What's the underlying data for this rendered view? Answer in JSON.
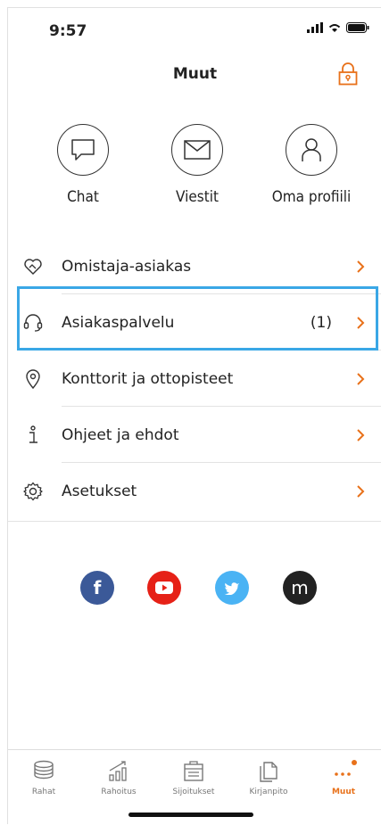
{
  "status": {
    "time": "9:57"
  },
  "header": {
    "title": "Muut"
  },
  "quick_actions": [
    {
      "label": "Chat"
    },
    {
      "label": "Viestit"
    },
    {
      "label": "Oma profiili"
    }
  ],
  "menu": {
    "items": [
      {
        "label": "Omistaja-asiakas",
        "count": ""
      },
      {
        "label": "Asiakaspalvelu",
        "count": "(1)"
      },
      {
        "label": "Konttorit ja ottopisteet",
        "count": ""
      },
      {
        "label": "Ohjeet ja ehdot",
        "count": ""
      },
      {
        "label": "Asetukset",
        "count": ""
      }
    ]
  },
  "social": [
    {
      "name": "facebook-icon",
      "glyph": "f",
      "color": "#3b5998"
    },
    {
      "name": "youtube-icon",
      "glyph": "",
      "color": "#e62117"
    },
    {
      "name": "twitter-icon",
      "glyph": "",
      "color": "#4ab3f4"
    },
    {
      "name": "medium-icon",
      "glyph": "m",
      "color": "#222222"
    }
  ],
  "tabs": [
    {
      "label": "Rahat"
    },
    {
      "label": "Rahoitus"
    },
    {
      "label": "Sijoitukset"
    },
    {
      "label": "Kirjanpito"
    },
    {
      "label": "Muut"
    }
  ],
  "colors": {
    "accent": "#e8711a",
    "highlight": "#3aa7e6"
  }
}
